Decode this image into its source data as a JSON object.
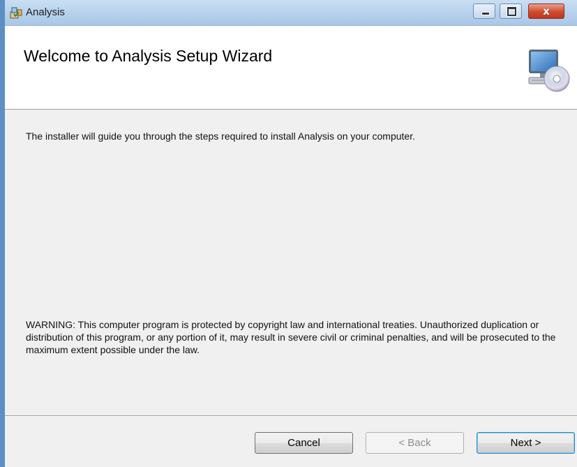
{
  "window": {
    "title": "Analysis",
    "controls": [
      "minimize-icon",
      "maximize-icon",
      "close-icon"
    ],
    "close_glyph": "x"
  },
  "banner": {
    "title": "Welcome to Analysis Setup Wizard",
    "icon": "computer-cd-icon"
  },
  "body": {
    "intro": "The installer will guide you through the steps required to install Analysis on your computer.",
    "warning": "WARNING: This computer program is protected by copyright law and international treaties. Unauthorized duplication or distribution of this program, or any portion of it, may result in severe civil or criminal penalties, and will be prosecuted to the maximum extent possible under the law."
  },
  "buttons": {
    "cancel": "Cancel",
    "back": "< Back",
    "next": "Next >"
  },
  "colors": {
    "titlebar": "#b7d1ec",
    "close_button": "#c0381d",
    "dialog_background": "#f0f0f0",
    "default_button_border": "#3c7fb1"
  }
}
